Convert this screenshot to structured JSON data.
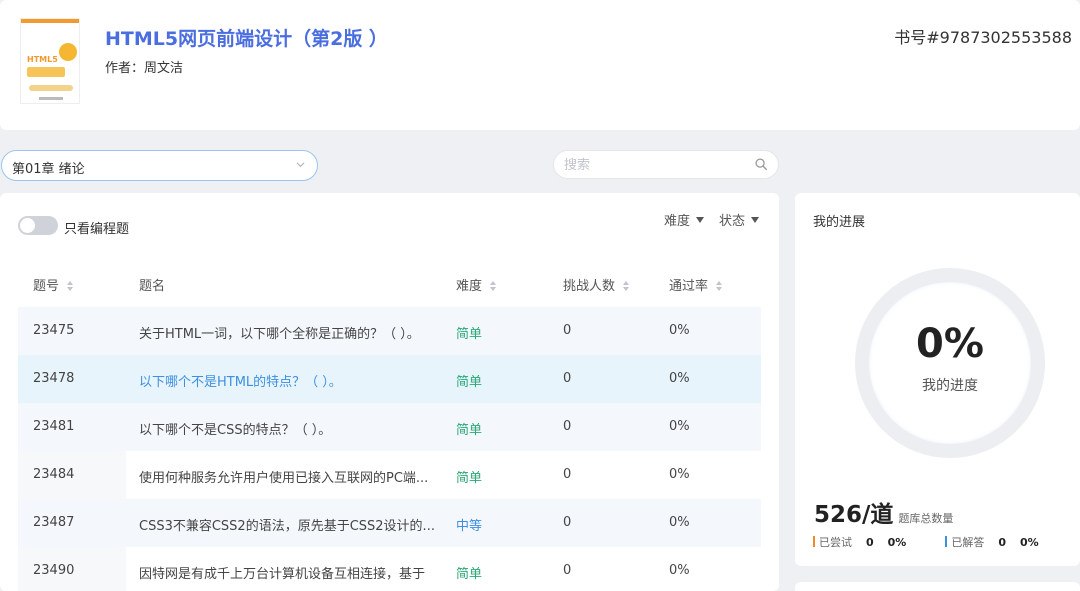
{
  "book": {
    "cover_title": "HTML5",
    "title": "HTML5网页前端设计（第2版 ）",
    "author": "作者：周文洁",
    "isbn": "书号#9787302553588"
  },
  "chapter_select": {
    "value": "第01章 绪论"
  },
  "search": {
    "placeholder": "搜索"
  },
  "filters": {
    "only_programming": "只看编程题",
    "difficulty": "难度",
    "status": "状态"
  },
  "table": {
    "headers": {
      "id": "题号",
      "title": "题名",
      "difficulty": "难度",
      "challengers": "挑战人数",
      "pass_rate": "通过率"
    },
    "rows": [
      {
        "id": "23475",
        "title": "关于HTML一词，以下哪个全称是正确的？（ ）。",
        "difficulty": "简单",
        "challengers": "0",
        "pass_rate": "0%"
      },
      {
        "id": "23478",
        "title": "以下哪个不是HTML的特点？（ ）。",
        "difficulty": "简单",
        "challengers": "0",
        "pass_rate": "0%"
      },
      {
        "id": "23481",
        "title": "以下哪个不是CSS的特点？（ ）。",
        "difficulty": "简单",
        "challengers": "0",
        "pass_rate": "0%"
      },
      {
        "id": "23484",
        "title": "使用何种服务允许用户使用已接入互联网的PC端...",
        "difficulty": "简单",
        "challengers": "0",
        "pass_rate": "0%"
      },
      {
        "id": "23487",
        "title": "CSS3不兼容CSS2的语法，原先基于CSS2设计的...",
        "difficulty": "中等",
        "challengers": "0",
        "pass_rate": "0%"
      },
      {
        "id": "23490",
        "title": "因特网是有成千上万台计算机设备互相连接，基于",
        "difficulty": "简单",
        "challengers": "0",
        "pass_rate": "0%"
      }
    ]
  },
  "progress": {
    "title": "我的进展",
    "percent": "0%",
    "percent_label": "我的进度",
    "total": "526/道",
    "total_label": "题库总数量",
    "tried_label": "已尝试",
    "tried_count": "0",
    "tried_pct": "0%",
    "solved_label": "已解答",
    "solved_count": "0",
    "solved_pct": "0%"
  },
  "colors": {
    "accent": "#4a6ee0",
    "easy": "#2aa876",
    "medium": "#3d8fe0",
    "tried": "#f08a24",
    "solved": "#3d8fe0"
  }
}
